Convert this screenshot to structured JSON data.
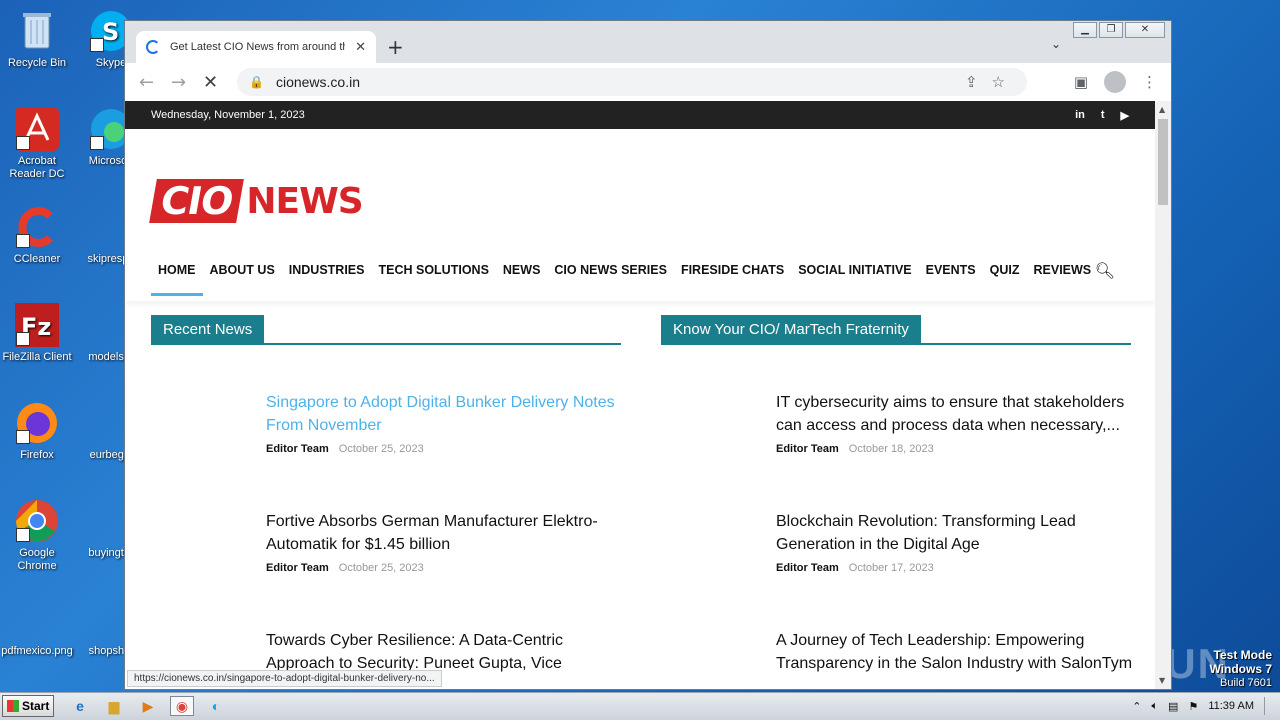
{
  "desktop": {
    "icons_col1": [
      {
        "label": "Recycle Bin",
        "icon": "recycle-bin-icon"
      },
      {
        "label": "Acrobat Reader DC",
        "icon": "acrobat-icon"
      },
      {
        "label": "CCleaner",
        "icon": "ccleaner-icon"
      },
      {
        "label": "FileZilla Client",
        "icon": "filezilla-icon"
      },
      {
        "label": "Firefox",
        "icon": "firefox-icon"
      },
      {
        "label": "Google Chrome",
        "icon": "chrome-icon"
      },
      {
        "label": "pdfmexico.png",
        "icon": "file-icon"
      }
    ],
    "icons_col2": [
      {
        "label": "Skype",
        "icon": "skype-icon"
      },
      {
        "label": "Microsoft",
        "icon": "edge-icon"
      },
      {
        "label": "skiprespo",
        "icon": "file-icon"
      },
      {
        "label": "modelsor",
        "icon": "file-icon"
      },
      {
        "label": "eurbegin",
        "icon": "file-icon"
      },
      {
        "label": "buyingter",
        "icon": "file-icon"
      },
      {
        "label": "shopshot",
        "icon": "file-icon"
      }
    ]
  },
  "browser": {
    "tab_title": "Get Latest CIO News from around the",
    "url": "cionews.co.in",
    "status_url": "https://cionews.co.in/singapore-to-adopt-digital-bunker-delivery-no..."
  },
  "site": {
    "date": "Wednesday, November 1, 2023",
    "social": [
      "in",
      "t",
      "▶"
    ],
    "logo": {
      "part1": "CIO",
      "part2": "NEWS"
    },
    "nav": [
      "HOME",
      "ABOUT US",
      "INDUSTRIES",
      "TECH SOLUTIONS",
      "NEWS",
      "CIO NEWS SERIES",
      "FIRESIDE CHATS",
      "SOCIAL INITIATIVE",
      "EVENTS",
      "QUIZ",
      "REVIEWS"
    ],
    "left": {
      "heading": "Recent News",
      "articles": [
        {
          "title": "Singapore to Adopt Digital Bunker Delivery Notes From November",
          "author": "Editor Team",
          "date": "October 25, 2023"
        },
        {
          "title": "Fortive Absorbs German Manufacturer Elektro-Automatik for $1.45 billion",
          "author": "Editor Team",
          "date": "October 25, 2023"
        },
        {
          "title": "Towards Cyber Resilience: A Data-Centric Approach to Security: Puneet Gupta, Vice",
          "author": "",
          "date": ""
        }
      ]
    },
    "right": {
      "heading": "Know Your CIO/ MarTech Fraternity",
      "articles": [
        {
          "title": "IT cybersecurity aims to ensure that stakeholders can access and process data when necessary,...",
          "author": "Editor Team",
          "date": "October 18, 2023"
        },
        {
          "title": "Blockchain Revolution: Transforming Lead Generation in the Digital Age",
          "author": "Editor Team",
          "date": "October 17, 2023"
        },
        {
          "title": "A Journey of Tech Leadership: Empowering Transparency in the Salon Industry with SalonTym",
          "author": "",
          "date": ""
        }
      ]
    }
  },
  "taskbar": {
    "start": "Start",
    "time": "11:39 AM"
  },
  "watermark": {
    "line1": "Test Mode",
    "line2": "Windows 7",
    "line3": "Build 7601",
    "brand": "ANY RUN"
  }
}
